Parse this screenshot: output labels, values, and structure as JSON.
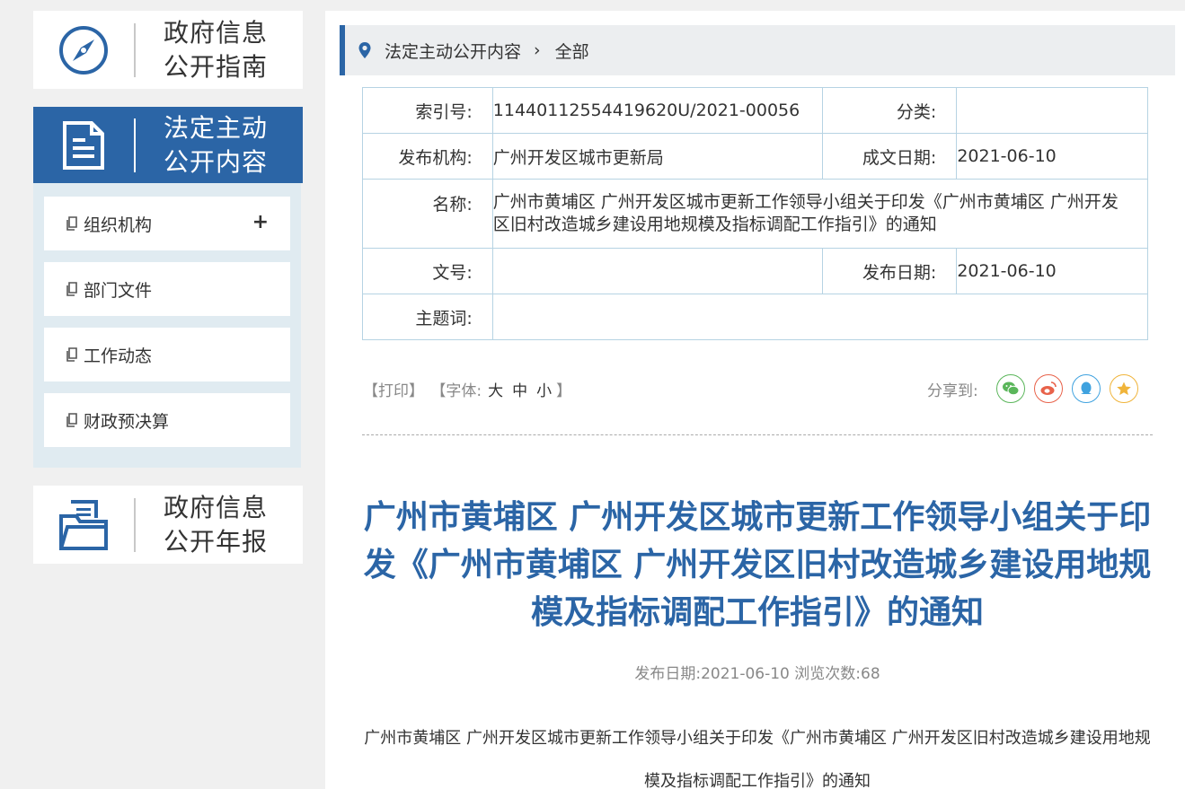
{
  "left": {
    "guide": {
      "line1": "政府信息",
      "line2": "公开指南",
      "icon": "compass-icon"
    },
    "active": {
      "line1": "法定主动",
      "line2": "公开内容",
      "icon": "document-icon"
    },
    "submenu": [
      {
        "label": "组织机构",
        "expand": "+"
      },
      {
        "label": "部门文件"
      },
      {
        "label": "工作动态"
      },
      {
        "label": "财政预决算"
      }
    ],
    "report": {
      "line1": "政府信息",
      "line2": "公开年报",
      "icon": "folder-icon"
    }
  },
  "breadcrumb": {
    "section": "法定主动公开内容",
    "current": "全部"
  },
  "meta": {
    "index_label": "索引号:",
    "index_value": "11440112554419620U/2021-00056",
    "category_label": "分类:",
    "category_value": "",
    "org_label": "发布机构:",
    "org_value": "广州开发区城市更新局",
    "written_label": "成文日期:",
    "written_value": "2021-06-10",
    "name_label": "名称:",
    "name_value": "广州市黄埔区 广州开发区城市更新工作领导小组关于印发《广州市黄埔区 广州开发区旧村改造城乡建设用地规模及指标调配工作指引》的通知",
    "docno_label": "文号:",
    "docno_value": "",
    "pubdate_label": "发布日期:",
    "pubdate_value": "2021-06-10",
    "subject_label": "主题词:",
    "subject_value": ""
  },
  "tools": {
    "print": "【打印】",
    "font_open": "【字体:",
    "big": "大",
    "mid": "中",
    "small": "小",
    "font_close": "】"
  },
  "share": {
    "label": "分享到:"
  },
  "article": {
    "title": "广州市黄埔区 广州开发区城市更新工作领导小组关于印发《广州市黄埔区 广州开发区旧村改造城乡建设用地规模及指标调配工作指引》的通知",
    "meta": "发布日期:2021-06-10 浏览次数:68",
    "body": "广州市黄埔区 广州开发区城市更新工作领导小组关于印发《广州市黄埔区 广州开发区旧村改造城乡建设用地规模及指标调配工作指引》的通知"
  },
  "colors": {
    "accent": "#2b65a6",
    "submenu_bg": "#e0ebf1",
    "border": "#b6d3e3"
  }
}
